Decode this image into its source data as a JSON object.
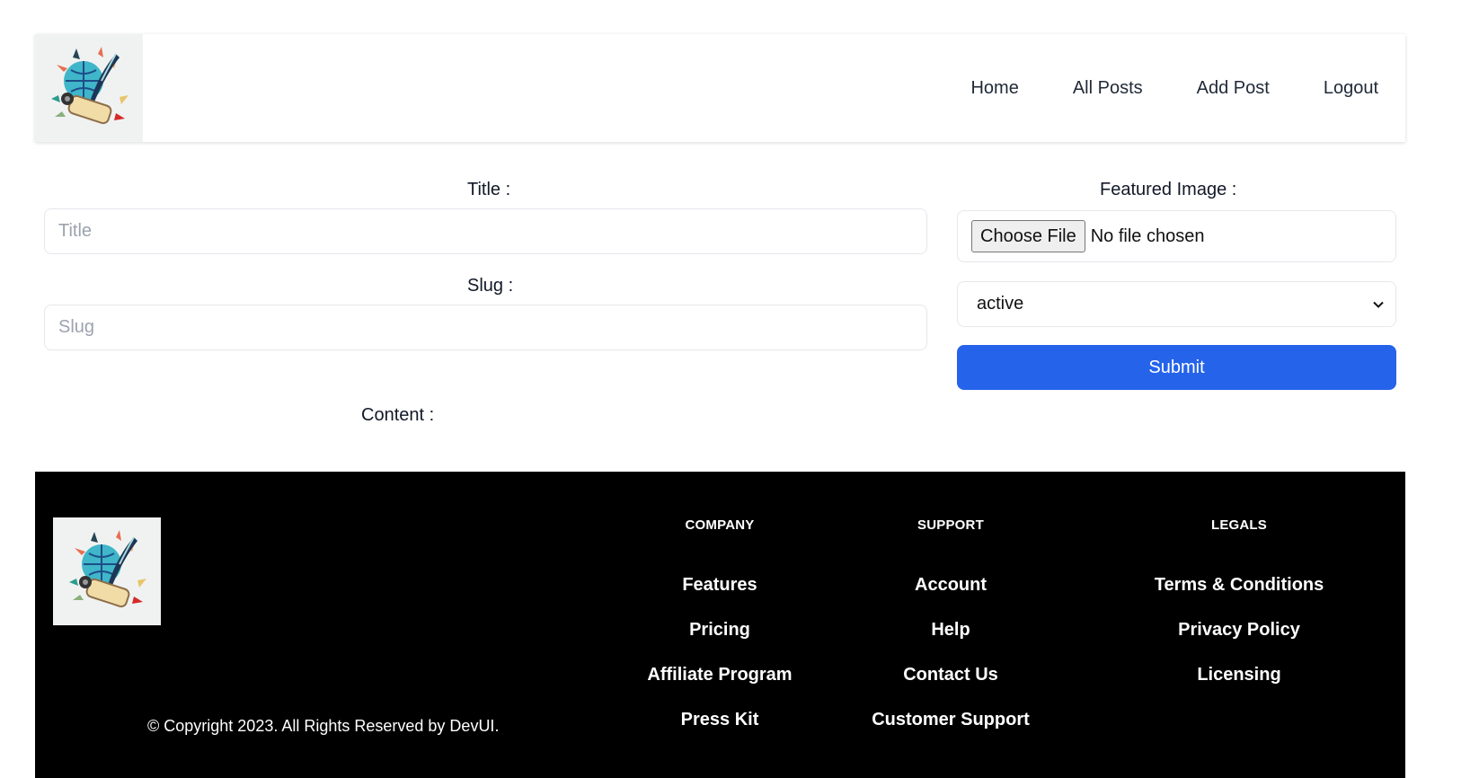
{
  "nav": {
    "logo_alt": "blog logo",
    "items": [
      {
        "label": "Home"
      },
      {
        "label": "All Posts"
      },
      {
        "label": "Add Post"
      },
      {
        "label": "Logout"
      }
    ]
  },
  "form": {
    "title_label": "Title :",
    "title_placeholder": "Title",
    "slug_label": "Slug :",
    "slug_placeholder": "Slug",
    "content_label": "Content :",
    "featured_image_label": "Featured Image :",
    "choose_file_label": "Choose File",
    "no_file_text": "No file chosen",
    "status_value": "active",
    "submit_label": "Submit"
  },
  "colors": {
    "submit_bg": "#2563eb",
    "footer_bg": "#000000"
  },
  "footer": {
    "copyright": "© Copyright 2023. All Rights Reserved by DevUI.",
    "columns": [
      {
        "heading": "COMPANY",
        "links": [
          "Features",
          "Pricing",
          "Affiliate Program",
          "Press Kit"
        ]
      },
      {
        "heading": "SUPPORT",
        "links": [
          "Account",
          "Help",
          "Contact Us",
          "Customer Support"
        ]
      },
      {
        "heading": "LEGALS",
        "links": [
          "Terms & Conditions",
          "Privacy Policy",
          "Licensing"
        ]
      }
    ]
  }
}
